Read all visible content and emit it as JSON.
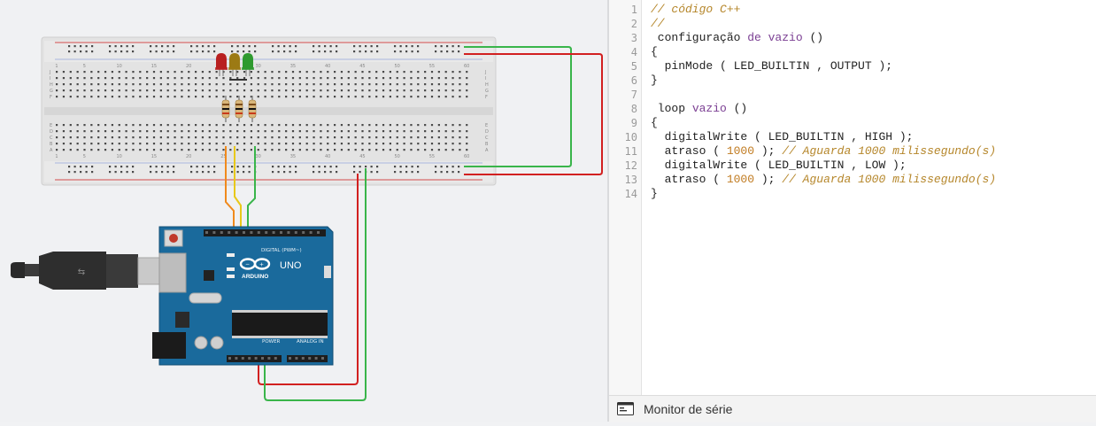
{
  "circuit": {
    "board_brand": "ARDUINO",
    "board_model": "UNO",
    "header_digital_label": "DIGITAL (PWM~)",
    "header_power_label": "POWER",
    "header_analog_label": "ANALOG IN",
    "led_colors": [
      "#b81f1f",
      "#9c7a14",
      "#2f9a2f"
    ],
    "wire_colors": {
      "red": "#d22020",
      "green": "#39b54a",
      "orange": "#f08a1c",
      "yellow": "#e8c81a"
    },
    "breadboard_top_numbers": [
      "1",
      "5",
      "10",
      "15",
      "20",
      "25",
      "30",
      "35",
      "40",
      "45",
      "50",
      "55",
      "60"
    ],
    "breadboard_row_letters_top": [
      "J",
      "I",
      "H",
      "G",
      "F"
    ],
    "breadboard_row_letters_bottom": [
      "E",
      "D",
      "C",
      "B",
      "A"
    ]
  },
  "code": {
    "language": "C++",
    "lines": [
      [
        {
          "t": "// código C++",
          "c": "comment"
        }
      ],
      [
        {
          "t": "//",
          "c": "comment"
        }
      ],
      [
        {
          "t": " configuração ",
          "c": "plain"
        },
        {
          "t": "de vazio",
          "c": "kw"
        },
        {
          "t": " ()",
          "c": "plain"
        }
      ],
      [
        {
          "t": "{",
          "c": "plain"
        }
      ],
      [
        {
          "t": "  pinMode ( LED_BUILTIN , OUTPUT );",
          "c": "plain"
        }
      ],
      [
        {
          "t": "}",
          "c": "plain"
        }
      ],
      [
        {
          "t": "",
          "c": "plain"
        }
      ],
      [
        {
          "t": " loop ",
          "c": "plain"
        },
        {
          "t": "vazio",
          "c": "kw"
        },
        {
          "t": " ()",
          "c": "plain"
        }
      ],
      [
        {
          "t": "{",
          "c": "plain"
        }
      ],
      [
        {
          "t": "  digitalWrite ( LED_BUILTIN , HIGH );",
          "c": "plain"
        }
      ],
      [
        {
          "t": "  atraso ( ",
          "c": "plain"
        },
        {
          "t": "1000",
          "c": "num"
        },
        {
          "t": " ); ",
          "c": "plain"
        },
        {
          "t": "// Aguarda 1000 milissegundo(s)",
          "c": "comment"
        }
      ],
      [
        {
          "t": "  digitalWrite ( LED_BUILTIN , LOW );",
          "c": "plain"
        }
      ],
      [
        {
          "t": "  atraso ( ",
          "c": "plain"
        },
        {
          "t": "1000",
          "c": "num"
        },
        {
          "t": " ); ",
          "c": "plain"
        },
        {
          "t": "// Aguarda 1000 milissegundo(s)",
          "c": "comment"
        }
      ],
      [
        {
          "t": "}",
          "c": "plain"
        }
      ]
    ],
    "line_numbers": [
      "1",
      "2",
      "3",
      "4",
      "5",
      "6",
      "7",
      "8",
      "9",
      "10",
      "11",
      "12",
      "13",
      "14"
    ]
  },
  "serial_monitor": {
    "label": "Monitor de série",
    "icon": "serial-monitor-icon"
  }
}
